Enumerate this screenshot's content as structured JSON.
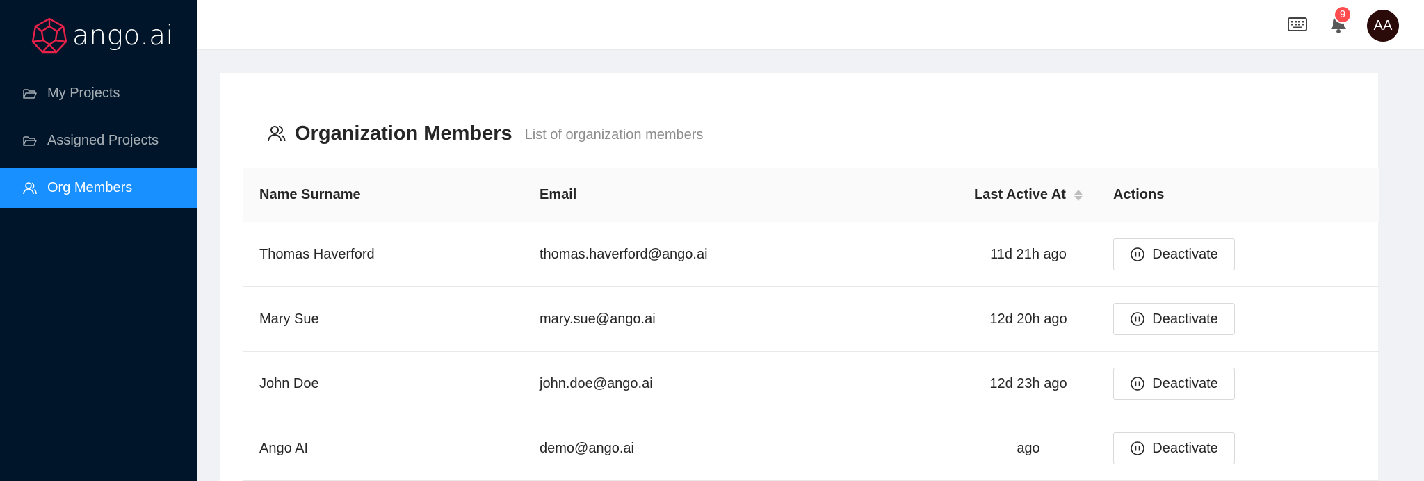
{
  "brand": {
    "name": "ango.ai",
    "accent": "#1890ff",
    "logo_color": "#e8214a"
  },
  "sidebar": {
    "items": [
      {
        "label": "My Projects",
        "icon": "folder-open-icon",
        "active": false
      },
      {
        "label": "Assigned Projects",
        "icon": "folder-open-icon",
        "active": false
      },
      {
        "label": "Org Members",
        "icon": "user-icon",
        "active": true
      }
    ]
  },
  "header": {
    "notifications_count": "9",
    "avatar_initials": "AA",
    "icons": [
      "keyboard-icon",
      "bell-icon"
    ]
  },
  "page": {
    "title": "Organization Members",
    "subtitle": "List of organization members"
  },
  "table": {
    "columns": [
      "Name Surname",
      "Email",
      "Last Active At",
      "Actions"
    ],
    "rows": [
      {
        "name": "Thomas Haverford",
        "email": "thomas.haverford@ango.ai",
        "last_active": "11d 21h ago",
        "action": "Deactivate"
      },
      {
        "name": "Mary Sue",
        "email": "mary.sue@ango.ai",
        "last_active": "12d 20h ago",
        "action": "Deactivate"
      },
      {
        "name": "John Doe",
        "email": "john.doe@ango.ai",
        "last_active": "12d 23h ago",
        "action": "Deactivate"
      },
      {
        "name": "Ango AI",
        "email": "demo@ango.ai",
        "last_active": "ago",
        "action": "Deactivate"
      }
    ]
  }
}
